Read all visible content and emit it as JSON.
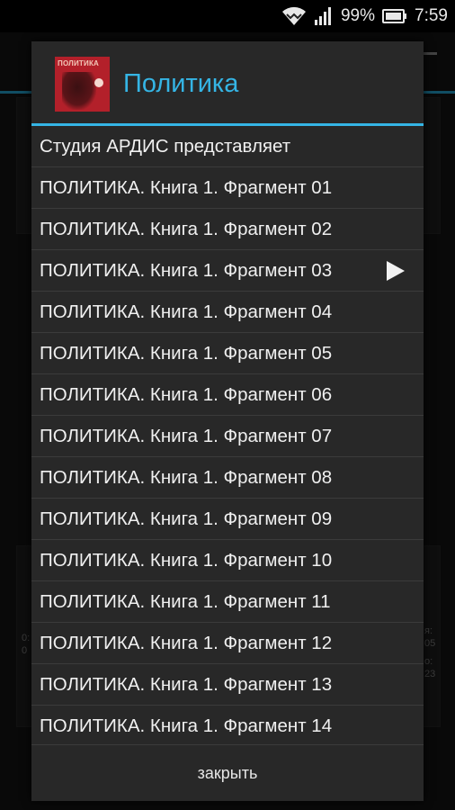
{
  "status_bar": {
    "battery": "99%",
    "time": "7:59",
    "icons": [
      "wifi-icon",
      "signal-icon",
      "battery-icon"
    ]
  },
  "background_app": {
    "left_stats": [
      "0:",
      "0"
    ],
    "right_stats": [
      "я:",
      "05",
      "о:",
      "23"
    ]
  },
  "dialog": {
    "title": "Политика",
    "cover": {
      "text": "ПОЛИТИКА",
      "icon": "book-cover-icon"
    },
    "items": [
      {
        "label": "Студия АРДИС представляет",
        "playing": false
      },
      {
        "label": "ПОЛИТИКА. Книга 1. Фрагмент 01",
        "playing": false
      },
      {
        "label": "ПОЛИТИКА. Книга 1. Фрагмент 02",
        "playing": false
      },
      {
        "label": "ПОЛИТИКА. Книга 1. Фрагмент 03",
        "playing": true
      },
      {
        "label": "ПОЛИТИКА. Книга 1. Фрагмент 04",
        "playing": false
      },
      {
        "label": "ПОЛИТИКА. Книга 1. Фрагмент 05",
        "playing": false
      },
      {
        "label": "ПОЛИТИКА. Книга 1. Фрагмент 06",
        "playing": false
      },
      {
        "label": "ПОЛИТИКА. Книга 1. Фрагмент 07",
        "playing": false
      },
      {
        "label": "ПОЛИТИКА. Книга 1. Фрагмент 08",
        "playing": false
      },
      {
        "label": "ПОЛИТИКА. Книга 1. Фрагмент 09",
        "playing": false
      },
      {
        "label": "ПОЛИТИКА. Книга 1. Фрагмент 10",
        "playing": false
      },
      {
        "label": "ПОЛИТИКА. Книга 1. Фрагмент 11",
        "playing": false
      },
      {
        "label": "ПОЛИТИКА. Книга 1. Фрагмент 12",
        "playing": false
      },
      {
        "label": "ПОЛИТИКА. Книга 1. Фрагмент 13",
        "playing": false
      },
      {
        "label": "ПОЛИТИКА. Книга 1. Фрагмент 14",
        "playing": false
      }
    ],
    "close_label": "закрыть"
  },
  "colors": {
    "accent": "#35b5e5",
    "dialog_bg": "#282828",
    "divider": "#3b3b3b"
  }
}
